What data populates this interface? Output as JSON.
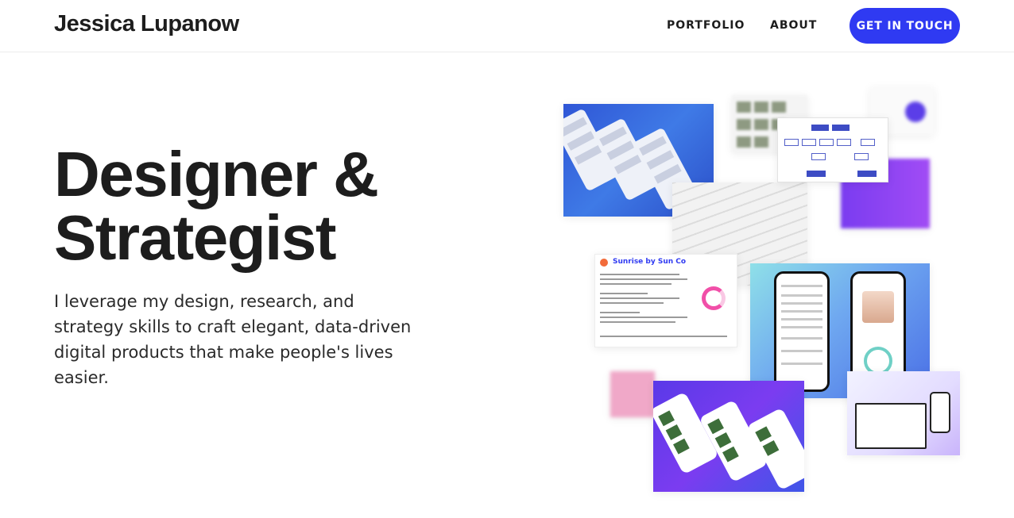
{
  "header": {
    "brand": "Jessica Lupanow",
    "nav": [
      {
        "label": "PORTFOLIO"
      },
      {
        "label": "ABOUT"
      }
    ],
    "cta_label": "GET IN TOUCH",
    "accent_color": "#2f3af2"
  },
  "hero": {
    "headline_line1": "Designer &",
    "headline_line2": "Strategist",
    "tagline": "I leverage my design, research, and strategy skills to craft elegant, data-driven digital products that make people's lives easier."
  },
  "collage": {
    "doc_title": "Sunrise by Sun Co"
  }
}
